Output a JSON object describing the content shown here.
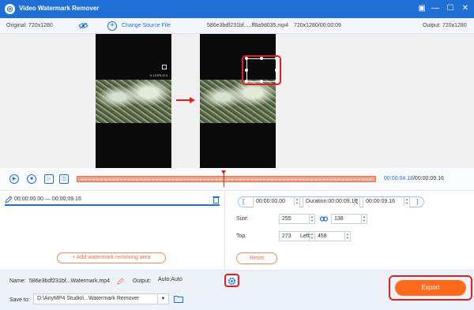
{
  "app": {
    "title": "Video Watermark Remover"
  },
  "toolbar": {
    "original_label": "Original: 720x1280",
    "change_source": "Change Source File",
    "filename": "586e3bdf231bf.....ff8a9d035.mp4",
    "resolution_duration": "720x1280/00:00:09",
    "output_label": "Output: 720x1280"
  },
  "preview": {
    "watermark_text": "lt 10TPL474"
  },
  "playback": {
    "current_time": "00:00:04.18",
    "total_time": "/00:00:09.16",
    "playhead_fraction": 0.48
  },
  "segment": {
    "range": "00:00:00.00 — 00:00:09.16"
  },
  "left": {
    "add_area_label": "Add watermark removing area"
  },
  "right": {
    "start": "00:00:00.00",
    "duration": "Duration:00:00:09.16",
    "end": "00:00:09.16",
    "size_label": "Size:",
    "width": "255",
    "height": "138",
    "top_label": "Top:",
    "top": "273",
    "left_label": "Left:",
    "left": "458",
    "reset_label": "Reset"
  },
  "footer": {
    "name_label": "Name:",
    "name_value": "586e3bdf231bf...Watermark.mp4",
    "output_label": "Output:",
    "output_value": "Auto;Auto",
    "save_label": "Save to:",
    "save_path": "D:\\AnyMP4 Studio\\...Watermark Remover",
    "export_label": "Export"
  },
  "colors": {
    "accent": "#1f6fd6",
    "export": "#ff6a1c",
    "highlight": "#e02020"
  },
  "icons": [
    "app-logo-icon",
    "minimize-icon",
    "maximize-icon",
    "close-icon",
    "eye-icon",
    "plus-icon",
    "play-icon",
    "stop-icon",
    "next-frame-icon",
    "crop-icon",
    "edit-icon",
    "delete-icon",
    "link-icon",
    "gear-icon",
    "folder-icon"
  ]
}
